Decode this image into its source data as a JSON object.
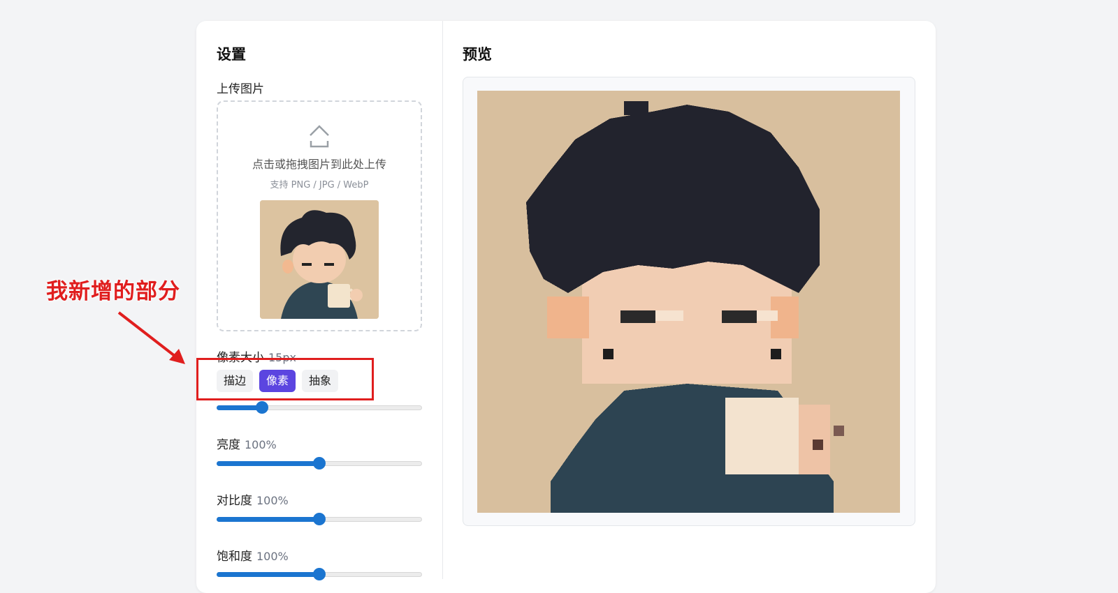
{
  "settings": {
    "title": "设置",
    "upload": {
      "label": "上传图片",
      "hint": "点击或拖拽图片到此处上传",
      "formats": "支持 PNG / JPG / WebP"
    },
    "pixel_size": {
      "label": "像素大小",
      "value": "15px",
      "level": 0.22
    },
    "modes": {
      "items": [
        "描边",
        "像素",
        "抽象"
      ],
      "selected": "像素"
    },
    "brightness": {
      "label": "亮度",
      "value": "100%",
      "level": 0.5
    },
    "contrast": {
      "label": "对比度",
      "value": "100%",
      "level": 0.5
    },
    "saturation": {
      "label": "饱和度",
      "value": "100%",
      "level": 0.5
    }
  },
  "preview": {
    "title": "预览"
  },
  "annotation": {
    "text": "我新增的部分",
    "color": "#e01e1e"
  },
  "colors": {
    "accent": "#5b45e0",
    "slider": "#1b75d0"
  }
}
